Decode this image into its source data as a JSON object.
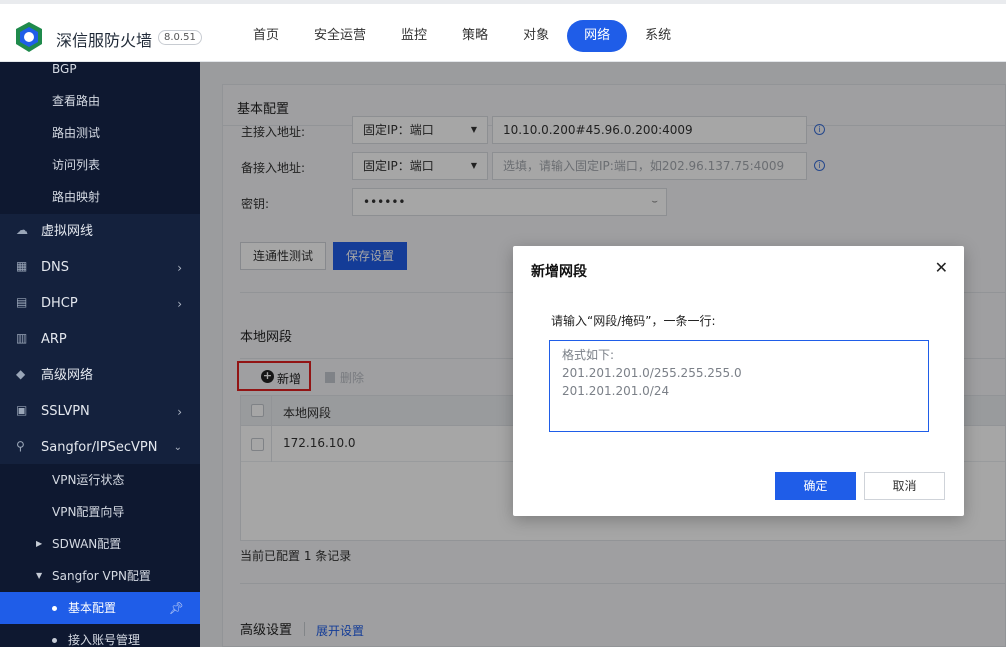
{
  "header": {
    "brand": "深信服防火墙",
    "version": "8.0.51",
    "nav": [
      "首页",
      "安全运营",
      "监控",
      "策略",
      "对象",
      "网络",
      "系统"
    ],
    "active_nav": "网络"
  },
  "sidebar": {
    "items": [
      {
        "label": "BGP",
        "icon": null
      },
      {
        "label": "查看路由",
        "icon": null
      },
      {
        "label": "路由测试",
        "icon": null
      },
      {
        "label": "访问列表",
        "icon": null
      },
      {
        "label": "路由映射",
        "icon": null
      },
      {
        "label": "虚拟网线",
        "icon": "cloud-icon"
      },
      {
        "label": "DNS",
        "icon": "dns-icon"
      },
      {
        "label": "DHCP",
        "icon": "dhcp-icon"
      },
      {
        "label": "ARP",
        "icon": "arp-icon"
      },
      {
        "label": "高级网络",
        "icon": "diamond-icon"
      },
      {
        "label": "SSLVPN",
        "icon": "sslvpn-icon"
      },
      {
        "label": "Sangfor/IPSecVPN",
        "icon": "network-icon"
      },
      {
        "label": "VPN运行状态",
        "icon": null
      },
      {
        "label": "VPN配置向导",
        "icon": null
      },
      {
        "label": "SDWAN配置",
        "icon": null
      },
      {
        "label": "Sangfor VPN配置",
        "icon": null
      },
      {
        "label": "基本配置",
        "icon": null
      },
      {
        "label": "接入账号管理",
        "icon": null
      }
    ]
  },
  "main": {
    "panel_title": "基本配置",
    "primary_label": "主接入地址:",
    "primary_type": "固定IP：端口",
    "primary_value": "10.10.0.200#45.96.0.200:4009",
    "backup_label": "备接入地址:",
    "backup_type": "固定IP：端口",
    "backup_placeholder": "选填，请输入固定IP:端口，如202.96.137.75:4009",
    "secret_label": "密钥:",
    "secret_value": "••••••",
    "test_button": "连通性测试",
    "save_button": "保存设置",
    "local_title": "本地网段",
    "add_button": "新增",
    "delete_button": "删除",
    "table_header": "本地网段",
    "table_rows": [
      "172.16.10.0"
    ],
    "record_info": "当前已配置 1 条记录",
    "advanced_title": "高级设置",
    "expand_link": "展开设置"
  },
  "modal": {
    "title": "新增网段",
    "close": "✕",
    "prompt": "请输入“网段/掩码”，一条一行:",
    "placeholder": "格式如下:\n201.201.201.0/255.255.255.0\n201.201.201.0/24",
    "ok": "确定",
    "cancel": "取消"
  }
}
